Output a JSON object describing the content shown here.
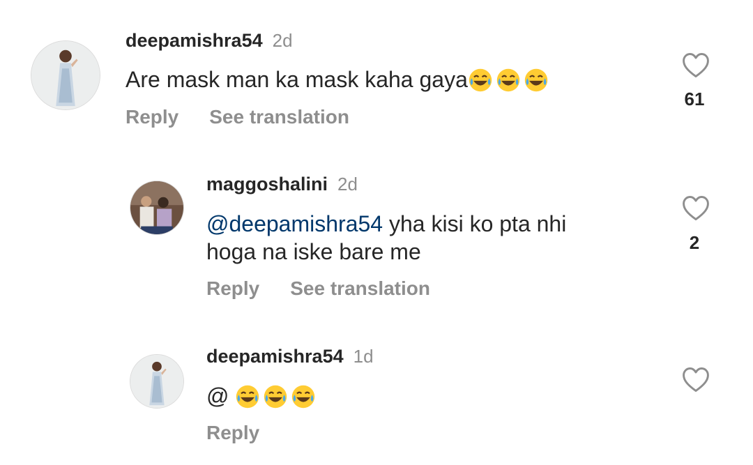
{
  "comments": [
    {
      "username": "deepamishra54",
      "time": "2d",
      "text": "Are mask man ka mask kaha gaya",
      "emoji_count": 3,
      "reply_label": "Reply",
      "translate_label": "See translation",
      "likes": "61"
    },
    {
      "username": "maggoshalini",
      "time": "2d",
      "mention": "@deepamishra54",
      "text_line1": " yha kisi ko pta nhi",
      "text_line2": "hoga na iske bare me",
      "reply_label": "Reply",
      "translate_label": "See translation",
      "likes": "2"
    },
    {
      "username": "deepamishra54",
      "time": "1d",
      "text": "@ ",
      "emoji_count": 3,
      "reply_label": "Reply"
    }
  ],
  "icons": {
    "like": "heart-outline-icon",
    "emoji": "face-with-tears-of-joy-emoji"
  },
  "colors": {
    "text": "#262626",
    "secondary": "#8e8e8e",
    "mention": "#00376b"
  }
}
